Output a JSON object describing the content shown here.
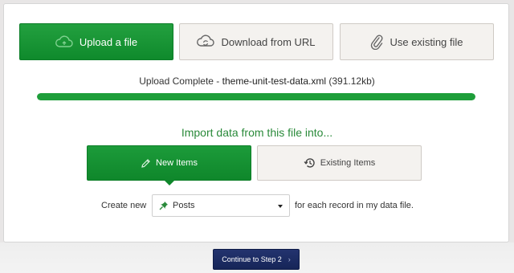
{
  "source_buttons": {
    "upload_label": "Upload a file",
    "download_label": "Download from URL",
    "existing_label": "Use existing file"
  },
  "upload": {
    "status_prefix": "Upload Complete - ",
    "filename": "theme-unit-test-data.xml",
    "size": "(391.12kb)",
    "progress_percent": 100
  },
  "import": {
    "heading": "Import data from this file into...",
    "new_items_label": "New Items",
    "existing_items_label": "Existing Items"
  },
  "create": {
    "prefix": "Create new",
    "post_type": "Posts",
    "suffix": "for each record in my data file."
  },
  "footer": {
    "continue_label": "Continue to Step 2",
    "continue_chevron": "›"
  },
  "colors": {
    "accent_green": "#1e9e3a",
    "navy_button": "#1c2b62"
  }
}
